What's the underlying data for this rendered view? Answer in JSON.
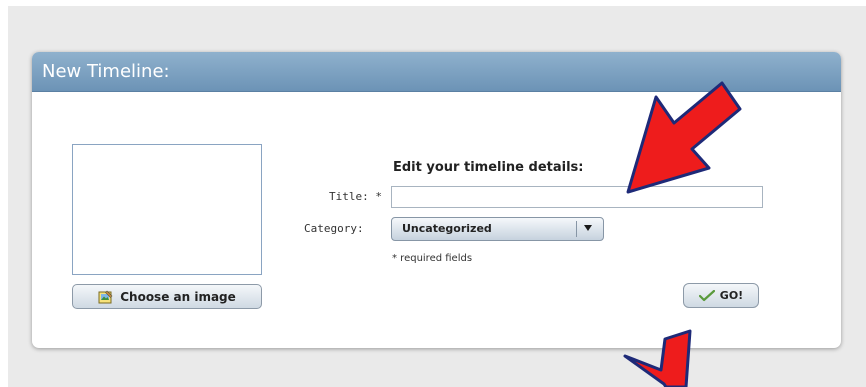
{
  "panel": {
    "title": "New Timeline:"
  },
  "image": {
    "choose_label": "Choose an image",
    "choose_icon": "image-edit-icon"
  },
  "form": {
    "heading": "Edit your timeline details:",
    "title_label": "Title: *",
    "title_value": "",
    "category_label": "Category:",
    "category_value": "Uncategorized",
    "required_note": "* required fields",
    "go_label": "GO!",
    "go_icon": "checkmark-icon"
  },
  "colors": {
    "header": "#7399bb",
    "arrow": "#ee1c1c",
    "arrow_outline": "#1e2a78"
  }
}
